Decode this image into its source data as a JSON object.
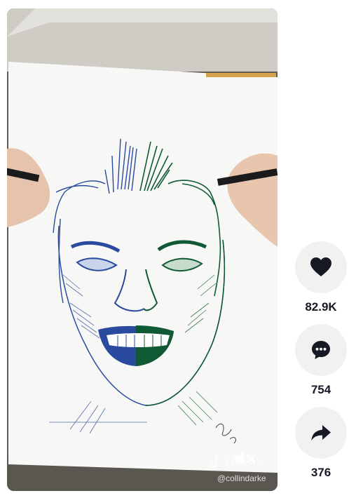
{
  "video": {
    "watermark": "TikTok",
    "handle": "@collindarke",
    "mute_icon": "speaker-muted-icon"
  },
  "actions": [
    {
      "name": "like",
      "icon": "heart-icon",
      "count": "82.9K"
    },
    {
      "name": "comment",
      "icon": "comment-icon",
      "count": "754"
    },
    {
      "name": "share",
      "icon": "share-icon",
      "count": "376"
    }
  ],
  "colors": {
    "button_bg": "#f1f1f2",
    "text": "#161823",
    "blue_ink": "#2a4aa0",
    "green_ink": "#0f5a34"
  }
}
